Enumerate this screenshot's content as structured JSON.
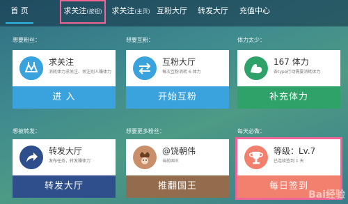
{
  "nav": {
    "items": [
      {
        "label": "首 页",
        "hint": ""
      },
      {
        "label": "求关注",
        "hint": "(按钮)"
      },
      {
        "label": "求关注",
        "hint": "(主页)"
      },
      {
        "label": "互粉大厅",
        "hint": ""
      },
      {
        "label": "转发大厅",
        "hint": ""
      },
      {
        "label": "充值中心",
        "hint": ""
      }
    ]
  },
  "sections": {
    "row1": [
      "想要粉丝：",
      "想要互粉：",
      "体力太少："
    ],
    "row2": [
      "想被转发：",
      "想要更多粉丝：",
      "每天必做："
    ]
  },
  "cards": [
    {
      "title": "求关注",
      "desc": "消耗体力求关注、关注别人赚体力",
      "button": "进 入",
      "icon": "upload-people-icon"
    },
    {
      "title": "互粉大厅",
      "desc": "每次互粉消耗 6 体力",
      "button": "开始互粉",
      "icon": "exchange-arrows-icon"
    },
    {
      "title": "167 体力",
      "desc": "各type行动需要消耗体力",
      "button": "补充体力",
      "icon": "muscle-arm-icon"
    },
    {
      "title": "转发大厅",
      "desc": "发布任务，转发赚体力",
      "button": "转发大厅",
      "icon": "forward-arrow-icon"
    },
    {
      "title": "@饶朝伟",
      "desc": "当前国王",
      "button": "推翻国王",
      "icon": "king-avatar-icon"
    },
    {
      "title": "等级：Lv.7",
      "desc": "已连续签到 1 天",
      "button": "每日签到",
      "icon": "trophy-icon"
    }
  ],
  "colors": {
    "blue": "#3aa3dd",
    "green": "#2ea269",
    "navy": "#2e4f8c",
    "brown": "#936b4d",
    "salmon": "#f2806f",
    "highlight": "#f06595"
  },
  "watermark": "Bai经验"
}
